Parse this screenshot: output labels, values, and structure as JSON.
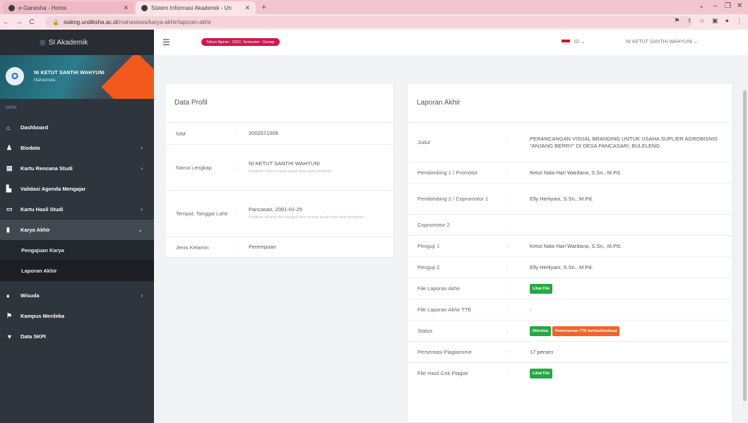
{
  "browser": {
    "tabs": [
      {
        "title": "e-Ganesha - Home",
        "active": false
      },
      {
        "title": "Sistem Informasi Akademik - Un",
        "active": true
      }
    ],
    "url_host": "siakng.undiksha.ac.id",
    "url_path": "/mahasiswa/karya-akhir/laporan-akhir"
  },
  "sidebar": {
    "brand": "SI Akademik",
    "profile_name": "NI KETUT SANTHI WAHYUNI",
    "profile_role": "Mahasiswa",
    "menu_heading": "MAIN",
    "items": [
      {
        "label": "Dashboard",
        "icon": "home-icon",
        "chevron": false
      },
      {
        "label": "Biodata",
        "icon": "user-icon",
        "chevron": true
      },
      {
        "label": "Kartu Rencana Studi",
        "icon": "document-icon",
        "chevron": true
      },
      {
        "label": "Validasi Agenda Mengajar",
        "icon": "file-check-icon",
        "chevron": false
      },
      {
        "label": "Kartu Hasil Studi",
        "icon": "id-card-icon",
        "chevron": true
      },
      {
        "label": "Karya Akhir",
        "icon": "book-icon",
        "chevron": true
      }
    ],
    "subitems": [
      {
        "label": "Pengajuan Karya"
      },
      {
        "label": "Laporan Akhir"
      }
    ],
    "items_after": [
      {
        "label": "Wisuda",
        "icon": "graduation-cap-icon",
        "chevron": true
      },
      {
        "label": "Kampus Merdeka",
        "icon": "flag-icon",
        "chevron": false
      },
      {
        "label": "Data SKPI",
        "icon": "trophy-icon",
        "chevron": false
      }
    ]
  },
  "topbar": {
    "period_pill": "Tahun Ajaran : 2022, Semester : Genap",
    "lang": "ID",
    "user": "NI KETUT SANTHI WAHYUNI"
  },
  "profil": {
    "title": "Data Profil",
    "rows": [
      {
        "key": "NIM",
        "value": "2002071009",
        "hint": ""
      },
      {
        "key": "Nama Lengkap",
        "value": "NI KETUT SANTHI WAHYUNI",
        "hint": "Pastikan nama sesuai ijazah atau akte kelahiran"
      },
      {
        "key": "Tempat, Tanggal Lahir",
        "value": "Pancasari, 2001-01-25",
        "hint": "Pastikan tempat dan tanggal lahir sesuai ijazah atau akte kelahiran"
      },
      {
        "key": "Jenis Kelamin",
        "value": "Perempuan",
        "hint": ""
      }
    ]
  },
  "laporan": {
    "title": "Laporan Akhir",
    "rows": [
      {
        "key": "Judul",
        "value": "PERANCANGAN VISUAL BRANDING UNTUK USAHA SUPLIER AGROBISNIS \"ANJANG BERRY\" DI DESA PANCASARI, BULELENG"
      },
      {
        "key": "Pembimbing 1 / Promotor",
        "value": "Ketut Nala Hari Wardana, S.Sn., M.Pd."
      },
      {
        "key": "Pembimbing 2 / Copromotor 1",
        "value": "Elly Herliyani, S.Sn., M.Pd."
      },
      {
        "key": "Copromotor 2",
        "value": ""
      },
      {
        "key": "Penguji 1",
        "value": "Ketut Nala Hari Wardana, S.Sn., M.Pd."
      },
      {
        "key": "Penguji 2",
        "value": "Elly Herliyani, S.Sn., M.Pd."
      },
      {
        "key": "File Laporan Akhir",
        "badge": "Lihat File"
      },
      {
        "key": "File Laporan Akhir TTE",
        "value": "-"
      },
      {
        "key": "Status",
        "badge": "Diterima",
        "badge2": "Pemrosesan TTE berhasil/selesai"
      },
      {
        "key": "Persentasi Plagiarisme",
        "value": "17 persen"
      },
      {
        "key": "File Hasil Cek Plagiat",
        "badge": "Lihat File"
      }
    ]
  },
  "colors": {
    "sidebar_bg": "#2e353d",
    "accent_pink": "#d0174f",
    "badge_green": "#28a745",
    "badge_orange": "#f0642c"
  }
}
